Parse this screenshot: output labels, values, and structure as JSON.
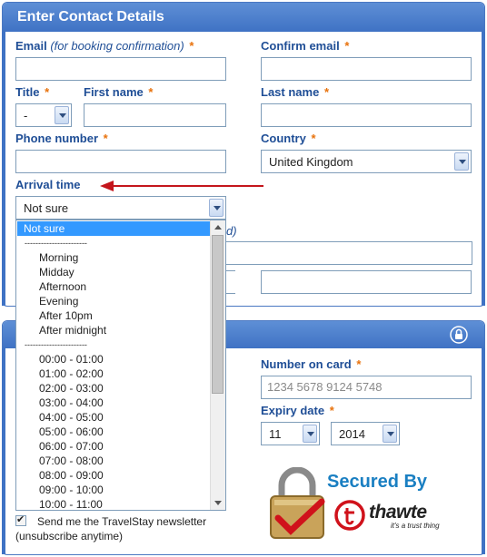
{
  "panel1": {
    "title": "Enter Contact Details",
    "email_label": "Email",
    "email_note": "(for booking confirmation)",
    "confirm_email_label": "Confirm email",
    "title_label": "Title",
    "title_value": "-",
    "first_name_label": "First name",
    "last_name_label": "Last name",
    "phone_label": "Phone number",
    "country_label": "Country",
    "country_value": "United Kingdom",
    "arrival_label": "Arrival time",
    "arrival_value": "Not sure",
    "partial_label": "d)",
    "required_star": "*"
  },
  "arrival_dropdown": {
    "options": [
      "Not sure",
      "-----------------------",
      "Morning",
      "Midday",
      "Afternoon",
      "Evening",
      "After 10pm",
      "After midnight",
      "-----------------------",
      "00:00 - 01:00",
      "01:00 - 02:00",
      "02:00 - 03:00",
      "03:00 - 04:00",
      "04:00 - 05:00",
      "05:00 - 06:00",
      "06:00 - 07:00",
      "07:00 - 08:00",
      "08:00 - 09:00",
      "09:00 - 10:00",
      "10:00 - 11:00"
    ],
    "selected_index": 0
  },
  "panel2": {
    "card_number_label": "Number on card",
    "card_number_placeholder": "1234 5678 9124 5748",
    "expiry_label": "Expiry date",
    "expiry_month": "11",
    "expiry_year": "2014",
    "secured_by": "Secured By",
    "thawte_name": "thawte",
    "thawte_tagline": "it's a trust thing",
    "required_star": "*"
  },
  "newsletter": {
    "label_line1": "Send me the TravelStay newsletter",
    "label_line2": "(unsubscribe anytime)",
    "checked": true
  },
  "colors": {
    "header_blue": "#3f72c4",
    "label_blue": "#1f4e96",
    "required_orange": "#e8720c",
    "arrow_red": "#c4161c",
    "highlight": "#3399ff"
  }
}
